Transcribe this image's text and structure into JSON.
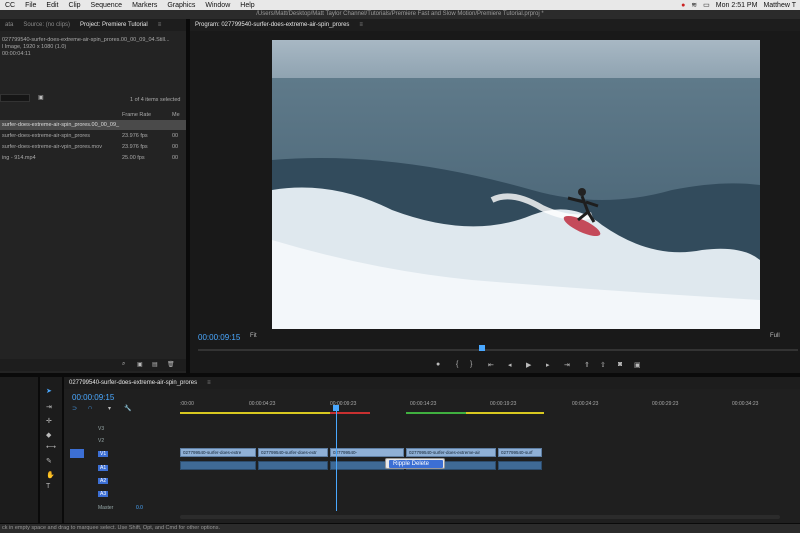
{
  "menubar": {
    "items": [
      "CC",
      "File",
      "Edit",
      "Clip",
      "Sequence",
      "Markers",
      "Graphics",
      "Window",
      "Help"
    ],
    "clock": "Mon 2:51 PM",
    "user": "Matthew T"
  },
  "titlebar": {
    "path": "/Users/Matt/Desktop/Matt Taylor Channel/Tutorials/Premiere Fast and Slow Motion/Premiere Tutorial.prproj *"
  },
  "project_panel": {
    "tabs": [
      "ata",
      "Source: (no clips)",
      "Project: Premiere Tutorial"
    ],
    "selected_name": "027799540-surfer-does-extreme-air-spin_prores.00_00_09_04.Still...",
    "selected_info": "l Image, 1920 x 1080 (1.0)",
    "selected_duration": "00:00:04:11",
    "items_selected": "1 of 4 items selected",
    "col_frame_rate": "Frame Rate",
    "col_media": "Me",
    "rows": [
      {
        "name": "surfer-does-extreme-air-spin_prores.00_00_09_",
        "rate": ""
      },
      {
        "name": "surfer-does-extreme-air-spin_prores",
        "rate": "23.976 fps",
        "media": "00"
      },
      {
        "name": "surfer-does-extreme-air-vpin_prores.mov",
        "rate": "23.976 fps",
        "media": "00"
      },
      {
        "name": "ing - 914.mp4",
        "rate": "25.00 fps",
        "media": "00"
      }
    ]
  },
  "program_monitor": {
    "tab": "Program: 027799540-surfer-does-extreme-air-spin_prores",
    "timecode": "00:00:09:15",
    "fit": "Fit",
    "quality": "Full"
  },
  "timeline": {
    "tab": "027799540-surfer-does-extreme-air-spin_prores",
    "timecode": "00:00:09:15",
    "ruler": [
      ":00:00",
      "00:00:04:23",
      "00:00:09:23",
      "00:00:14:23",
      "00:00:19:23",
      "00:00:24:23",
      "00:00:29:23",
      "00:00:34:23"
    ],
    "tracks_video": [
      "V3",
      "V2",
      "V1"
    ],
    "tracks_audio": [
      "A1",
      "A2",
      "A3"
    ],
    "master_label": "Master",
    "master_value": "0.0",
    "clips": [
      {
        "label": "027799540-surfer-does-extre"
      },
      {
        "label": "027799540-surfer-does-extr"
      },
      {
        "label": "027799540-"
      },
      {
        "label": "027799540-surfer-does-extreme-air"
      },
      {
        "label": "027799540-surf"
      }
    ]
  },
  "context_menu": {
    "item": "Ripple Delete"
  },
  "status": "ck in empty space and drag to marquee select. Use Shift, Opt, and Cmd for other options.",
  "colors": {
    "accent": "#3c6fd4",
    "timecode": "#4aa8ff",
    "clip": "#8fb0d6"
  }
}
